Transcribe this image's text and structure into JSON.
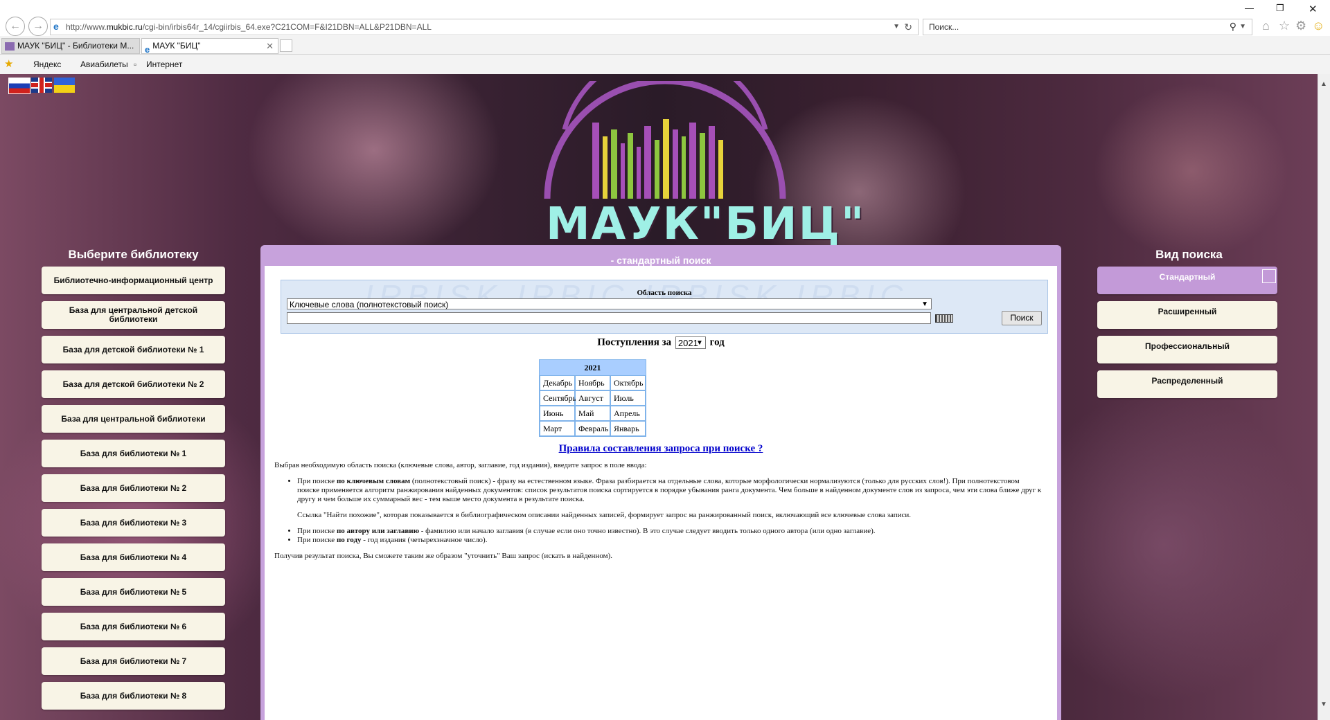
{
  "browser": {
    "url_prefix": "http://www.",
    "url_host": "mukbic.ru",
    "url_rest": "/cgi-bin/irbis64r_14/cgiirbis_64.exe?C21COM=F&I21DBN=ALL&P21DBN=ALL",
    "search_placeholder": "Поиск...",
    "tabs": [
      {
        "label": "МАУК \"БИЦ\" - Библиотеки М..."
      },
      {
        "label": "МАУК \"БИЦ\""
      }
    ],
    "favorites": [
      "Яндекс",
      "Авиабилеты",
      "Интернет"
    ]
  },
  "logo_text": "МАУК\"БИЦ\"",
  "libraries": {
    "heading": "Выберите библиотеку",
    "items": [
      "Библиотечно-информационный центр",
      "База для центральной детской библиотеки",
      "База для детской библиотеки № 1",
      "База для детской библиотеки № 2",
      "База для центральной библиотеки",
      "База для библиотеки № 1",
      "База для библиотеки № 2",
      "База для библиотеки № 3",
      "База для библиотеки № 4",
      "База для библиотеки № 5",
      "База для библиотеки № 6",
      "База для библиотеки № 7",
      "База для библиотеки № 8"
    ]
  },
  "search_types": {
    "heading": "Вид поиска",
    "items": [
      "Стандартный",
      "Расширенный",
      "Профессиональный",
      "Распределенный"
    ],
    "active": "Стандартный"
  },
  "main": {
    "title": "- стандартный поиск",
    "area_label": "Область поиска",
    "area_value": "Ключевые слова (полнотекстовый поиск)",
    "search_button": "Поиск",
    "arrivals_prefix": "Поступления за",
    "arrivals_year": "2021",
    "arrivals_suffix": "год",
    "calendar": {
      "year": "2021",
      "rows": [
        [
          "Декабрь",
          "Ноябрь",
          "Октябрь"
        ],
        [
          "Сентябрь",
          "Август",
          "Июль"
        ],
        [
          "Июнь",
          "Май",
          "Апрель"
        ],
        [
          "Март",
          "Февраль",
          "Январь"
        ]
      ]
    },
    "rules_link": "Правила составления запроса при поиске ?",
    "help": {
      "intro": "Выбрав необходимую область поиска (ключевые слова, автор, заглавие, год издания), введите запрос в поле ввода:",
      "kw_prefix": "При поиске ",
      "kw_bold": "по ключевым словам",
      "kw_text": " (полнотекстовый поиск) - фразу на естественном языке. Фраза разбирается на отдельные слова, которые морфологически нормализуются (только для русских слов!). При полнотекстовом поиске применяется алгоритм ранжирования найденных документов: список результатов поиска сортируется в порядке убывания ранга документа. Чем больше в найденном документе слов из запроса, чем эти слова ближе друг к другу и чем больше их суммарный вес - тем выше место документа в результате поиска.",
      "similar": "Ссылка \"Найти похожие\", которая показывается в библиографическом описании найденных записей, формирует запрос на ранжированный поиск, включающий все ключевые слова записи.",
      "author_prefix": "При поиске ",
      "author_bold": "по автору или заглавию",
      "author_text": " - фамилию или начало заглавия (в случае если оно точно известно). В это случае следует вводить только одного автора (или одно заглавие).",
      "year_prefix": "При поиске ",
      "year_bold": "по году",
      "year_text": " - год издания (четырехзначное число).",
      "outro": "Получив результат поиска, Вы сможете таким же образом \"уточнить\" Ваш запрос (искать в найденном)."
    }
  }
}
